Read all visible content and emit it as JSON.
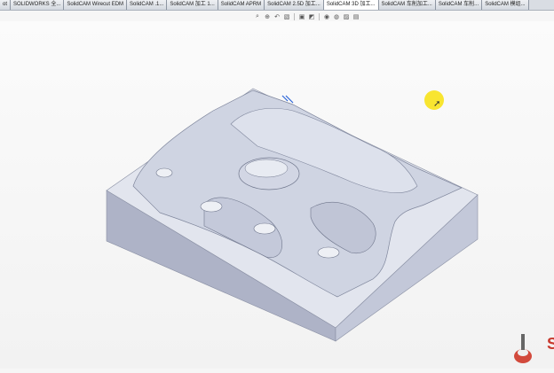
{
  "tabs": [
    {
      "label": "ot"
    },
    {
      "label": "SOLIDWORKS 全..."
    },
    {
      "label": "SolidCAM Wirecut EDM"
    },
    {
      "label": "SolidCAM .1..."
    },
    {
      "label": "SolidCAM 加工 1..."
    },
    {
      "label": "SolidCAM APRM"
    },
    {
      "label": "SolidCAM 2.5D 加工..."
    },
    {
      "label": "SolidCAM 3D 加工..."
    },
    {
      "label": "SolidCAM 车削加工..."
    },
    {
      "label": "SolidCAM 车削..."
    },
    {
      "label": "SolidCAM 模组..."
    }
  ],
  "active_tab": 7,
  "toolbar_icons": [
    "zoom-fit-icon",
    "zoom-area-icon",
    "previous-view-icon",
    "section-view-icon",
    "view-orientation-icon",
    "display-style-icon",
    "hide-show-icon",
    "appearance-icon",
    "scene-icon",
    "display-settings-icon"
  ],
  "logo": {
    "letter": "S"
  },
  "colors": {
    "model_top": "#d8dce8",
    "model_side": "#b8bdcf",
    "highlight": "#f7e21a",
    "logo_red": "#c8392e"
  }
}
